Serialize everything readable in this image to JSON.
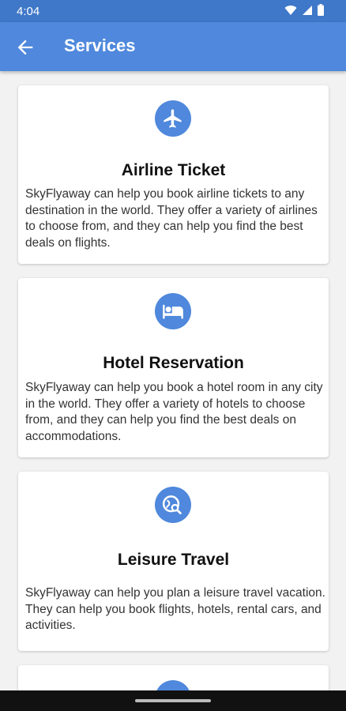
{
  "status_bar": {
    "time": "4:04"
  },
  "app_bar": {
    "title": "Services"
  },
  "services": [
    {
      "title": "Airline Ticket",
      "description": "SkyFlyaway can help you book airline tickets to any destination in the world. They offer a variety of airlines to choose from, and they can help you find the best deals on flights.",
      "icon": "airplane-icon"
    },
    {
      "title": "Hotel Reservation",
      "description": "SkyFlyaway can help you book a hotel room in any city in the world. They offer a variety of hotels to choose from, and they can help you find the best deals on accommodations.",
      "icon": "hotel-bed-icon"
    },
    {
      "title": "Leisure Travel",
      "description": "SkyFlyaway can help you plan a leisure travel vacation. They can help you book flights, hotels, rental cars, and activities.",
      "icon": "travel-explore-icon"
    }
  ],
  "colors": {
    "primary": "#4f88dc",
    "status_bar": "#3f78c8"
  }
}
